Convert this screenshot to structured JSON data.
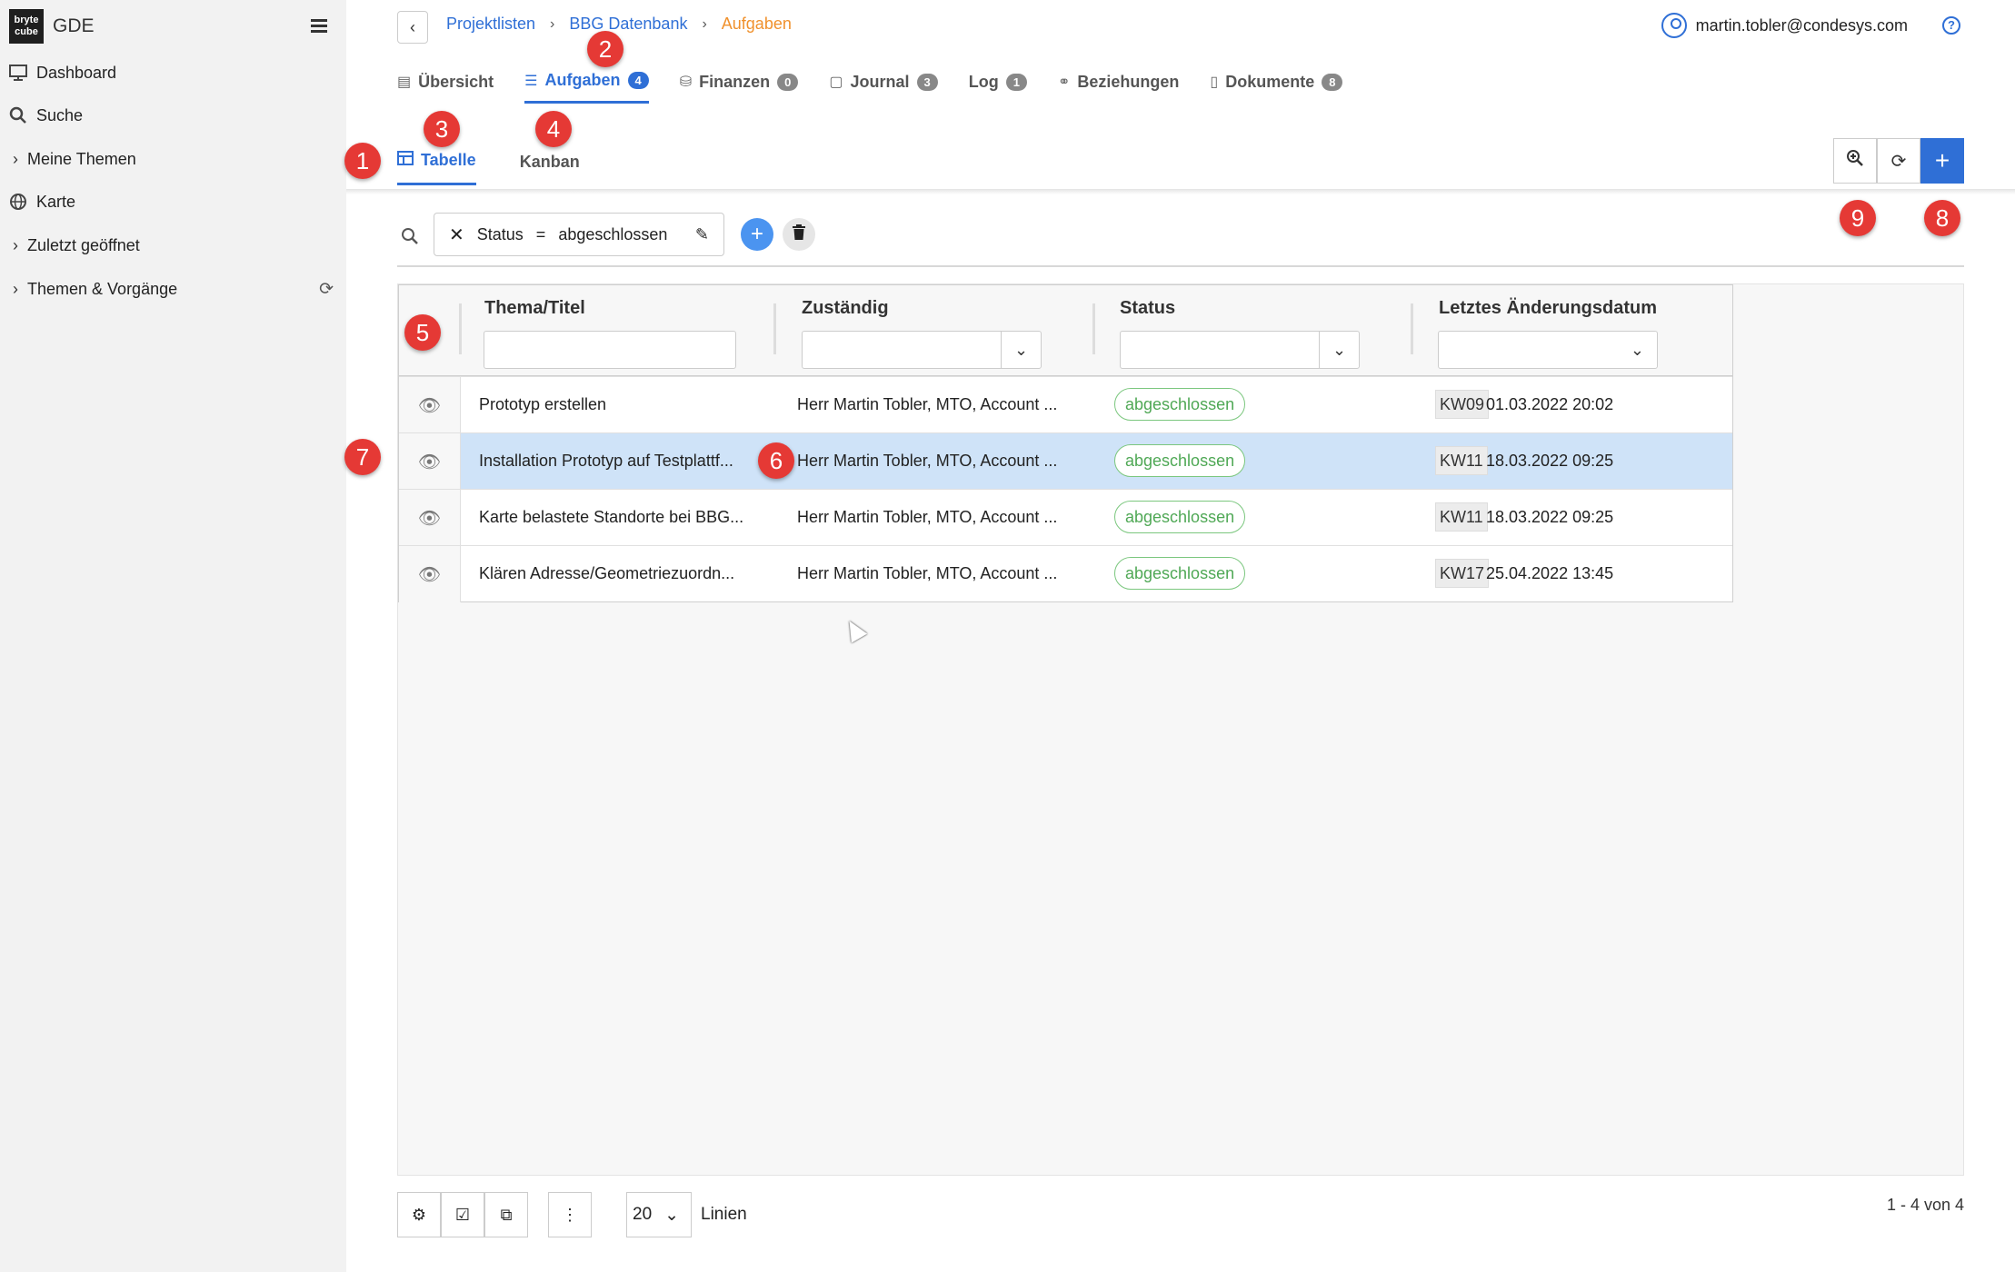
{
  "app": {
    "title": "GDE",
    "logo_text": "bryte cube"
  },
  "sidebar": {
    "items": [
      {
        "label": "Dashboard",
        "icon": "monitor-icon"
      },
      {
        "label": "Suche",
        "icon": "search-icon"
      },
      {
        "label": "Meine Themen",
        "icon": "chevron-right-icon"
      },
      {
        "label": "Karte",
        "icon": "globe-icon"
      },
      {
        "label": "Zuletzt geöffnet",
        "icon": "chevron-right-icon"
      },
      {
        "label": "Themen & Vorgänge",
        "icon": "chevron-right-icon"
      }
    ]
  },
  "breadcrumb": {
    "items": [
      "Projektlisten",
      "BBG Datenbank"
    ],
    "current": "Aufgaben"
  },
  "user": {
    "email": "martin.tobler@condesys.com"
  },
  "tabs": [
    {
      "label": "Übersicht",
      "badge": ""
    },
    {
      "label": "Aufgaben",
      "badge": "4"
    },
    {
      "label": "Finanzen",
      "badge": "0"
    },
    {
      "label": "Journal",
      "badge": "3"
    },
    {
      "label": "Log",
      "badge": "1"
    },
    {
      "label": "Beziehungen",
      "badge": ""
    },
    {
      "label": "Dokumente",
      "badge": "8"
    }
  ],
  "subtabs": [
    {
      "label": "Tabelle"
    },
    {
      "label": "Kanban"
    }
  ],
  "filter": {
    "field": "Status",
    "operator": "=",
    "value": "abgeschlossen"
  },
  "table": {
    "columns": [
      "Thema/Titel",
      "Zuständig",
      "Status",
      "Letztes Änderungsdatum"
    ],
    "rows": [
      {
        "title": "Prototyp erstellen",
        "assignee": "Herr Martin Tobler, MTO, Account ...",
        "status": "abgeschlossen",
        "kw": "KW09",
        "date": "01.03.2022 20:02"
      },
      {
        "title": "Installation Prototyp auf Testplattf...",
        "assignee": "Herr Martin Tobler, MTO, Account ...",
        "status": "abgeschlossen",
        "kw": "KW11",
        "date": "18.03.2022 09:25"
      },
      {
        "title": "Karte belastete Standorte bei BBG...",
        "assignee": "Herr Martin Tobler, MTO, Account ...",
        "status": "abgeschlossen",
        "kw": "KW11",
        "date": "18.03.2022 09:25"
      },
      {
        "title": "Klären Adresse/Geometriezuordn...",
        "assignee": "Herr Martin Tobler, MTO, Account ...",
        "status": "abgeschlossen",
        "kw": "KW17",
        "date": "25.04.2022 13:45"
      }
    ]
  },
  "footer": {
    "page_size": "20",
    "page_size_label": "Linien",
    "count": "1 - 4 von 4"
  },
  "markers": [
    "1",
    "2",
    "3",
    "4",
    "5",
    "6",
    "7",
    "8",
    "9"
  ],
  "colors": {
    "accent": "#2f6fd6",
    "breadcrumb_current": "#f0912d",
    "status_green": "#4fa855",
    "marker_red": "#e53935",
    "selected_row": "#cfe3f8"
  }
}
